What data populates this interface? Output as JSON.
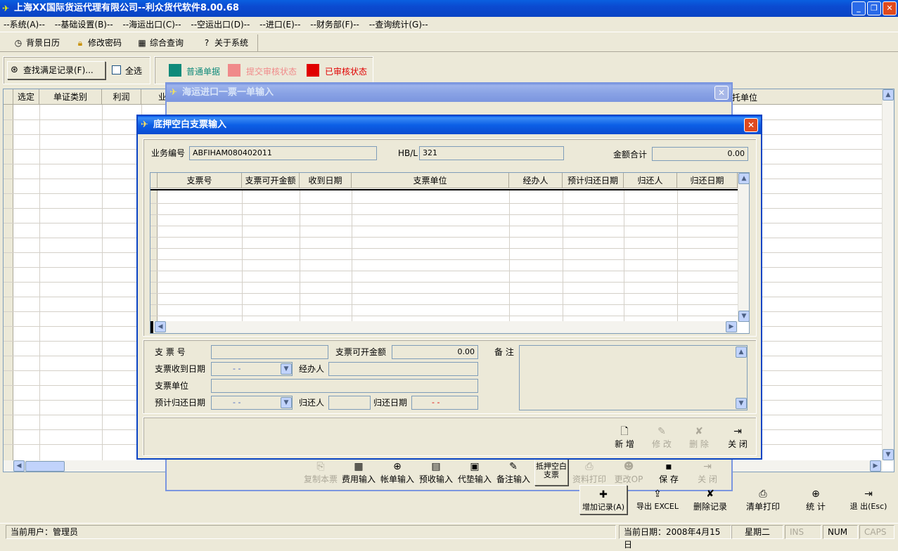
{
  "window": {
    "title": "上海XX国际货运代理有限公司--利众货代软件8.00.68"
  },
  "menu": [
    "--系统(A)--",
    "--基础设置(B)--",
    "--海运出口(C)--",
    "--空运出口(D)--",
    "--进口(E)--",
    "--财务部(F)--",
    "--查询统计(G)--"
  ],
  "toolbar": {
    "calendar": "背景日历",
    "password": "修改密码",
    "query": "综合查询",
    "about": "关于系统"
  },
  "filter": {
    "find": "查找满足记录(F)...",
    "select_all": "全选"
  },
  "legend": [
    {
      "label": "普通单据",
      "color": "#0f8a7a"
    },
    {
      "label": "提交审核状态",
      "color": "#f08a8a"
    },
    {
      "label": "已审核状态",
      "color": "#e00000"
    }
  ],
  "main_grid": {
    "headers": [
      "选定",
      "单证类别",
      "利润",
      "业"
    ],
    "right_header": "托单位"
  },
  "mid_dialog": {
    "title": "海运进口一票一单输入",
    "buttons": [
      "复制本票",
      "费用输入",
      "帐单输入",
      "预收输入",
      "代垫输入",
      "备注输入",
      "抵押空白支票",
      "资料打印",
      "更改OP",
      "保 存",
      "关 闭"
    ]
  },
  "dialog": {
    "title": "底押空白支票输入",
    "biz_no_label": "业务编号",
    "biz_no": "ABFIHAM080402011",
    "hbl_label": "HB/L",
    "hbl": "321",
    "total_label": "金额合计",
    "total": "0.00",
    "headers": [
      "支票号",
      "支票可开金额",
      "收到日期",
      "支票单位",
      "经办人",
      "预计归还日期",
      "归还人",
      "归还日期"
    ],
    "form": {
      "cheque_no": "支 票 号",
      "amount": "支票可开金额",
      "amount_val": "0.00",
      "remark": "备 注",
      "recv_date": "支票收到日期",
      "recv_date_val": "- -",
      "handler": "经办人",
      "unit": "支票单位",
      "plan_date": "预计归还日期",
      "plan_date_val": "- -",
      "returner": "归还人",
      "return_date": "归还日期",
      "return_date_val": "- -"
    },
    "actions": {
      "add": "新 增",
      "edit": "修 改",
      "delete": "删 除",
      "close": "关 闭"
    }
  },
  "bottom_actions": {
    "add": "增加记录(A)",
    "export": "导出 EXCEL",
    "delete": "删除记录",
    "print": "清单打印",
    "stats": "统 计",
    "exit": "退 出(Esc)"
  },
  "status": {
    "user": "当前用户：管理员",
    "date": "当前日期：2008年4月15日",
    "weekday": "星期二",
    "ins": "INS",
    "num": "NUM",
    "caps": "CAPS"
  }
}
